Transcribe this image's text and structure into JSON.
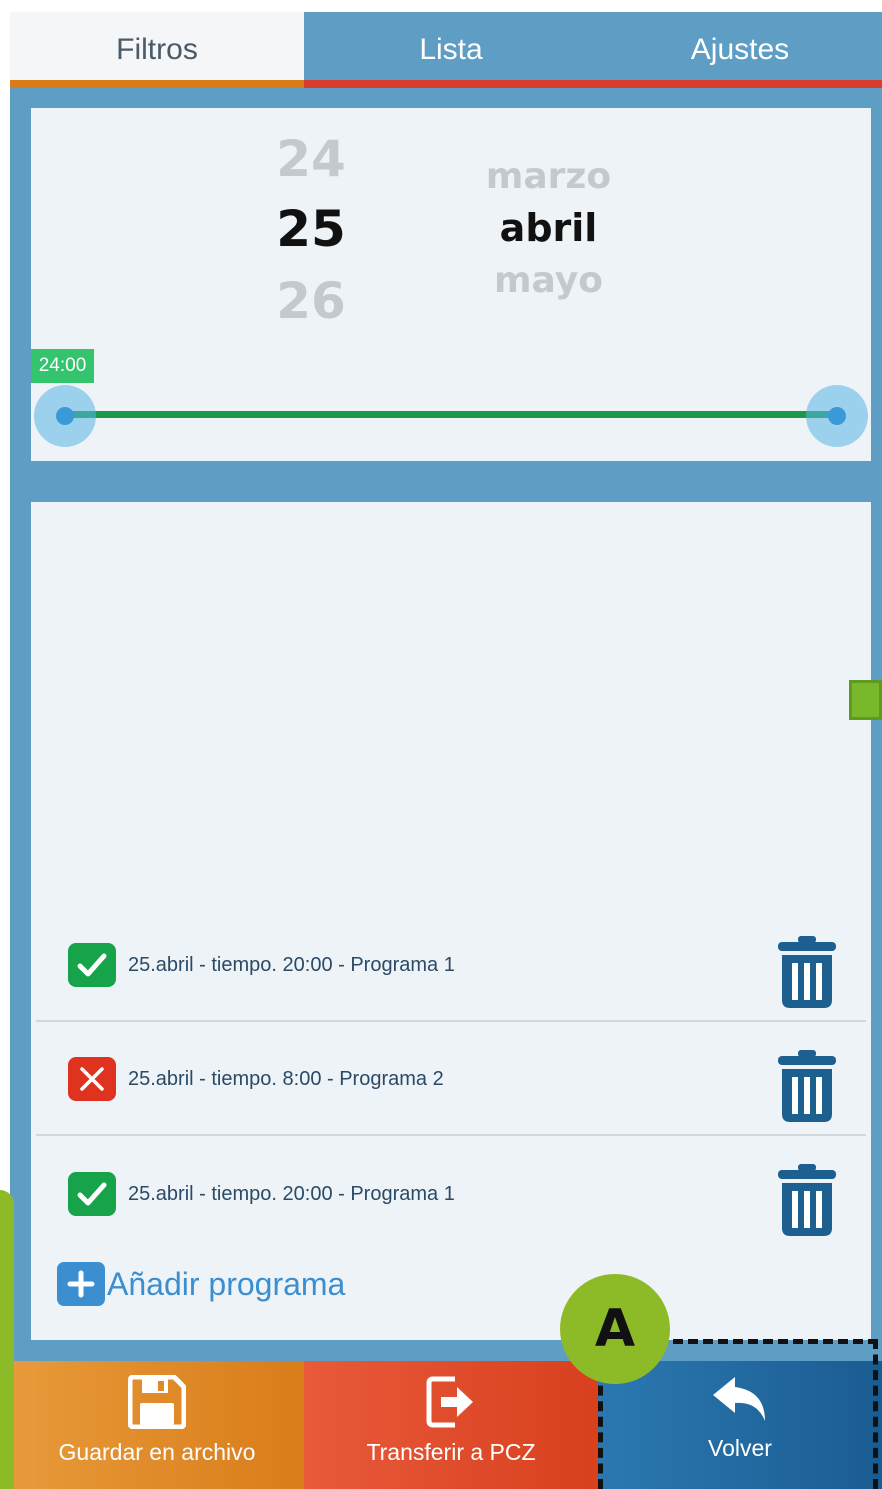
{
  "tabs": [
    {
      "label": "Filtros",
      "active": true
    },
    {
      "label": "Lista",
      "active": false
    },
    {
      "label": "Ajustes",
      "active": false
    }
  ],
  "date_picker": {
    "day_prev": "24",
    "day_selected": "25",
    "day_next": "26",
    "month_prev": "marzo",
    "month_selected": "abril",
    "month_next": "mayo"
  },
  "time_slider": {
    "badge": "24:00"
  },
  "programs": [
    {
      "status": "enabled",
      "label": "25.abril - tiempo. 20:00 - Programa 1"
    },
    {
      "status": "disabled",
      "label": "25.abril - tiempo. 8:00 - Programa 2"
    },
    {
      "status": "enabled",
      "label": "25.abril - tiempo. 20:00 - Programa 1"
    }
  ],
  "add_program": {
    "label": "Añadir programa"
  },
  "actions": {
    "save": "Guardar en archivo",
    "transfer": "Transferir a PCZ",
    "back": "Volver"
  },
  "annotation": {
    "marker": "A"
  },
  "icons": {
    "check": "check-icon",
    "cross": "close-icon",
    "trash": "trash-icon",
    "plus": "plus-icon",
    "save": "floppy-disk-icon",
    "transfer": "export-arrow-icon",
    "back": "reply-arrow-icon"
  },
  "colors": {
    "accent_blue": "#5f9ec4",
    "ok_green": "#17a34a",
    "error_red": "#e0331f",
    "save_orange": "#d97c1a",
    "transfer_red": "#d8401e",
    "back_blue": "#1a5c92"
  }
}
